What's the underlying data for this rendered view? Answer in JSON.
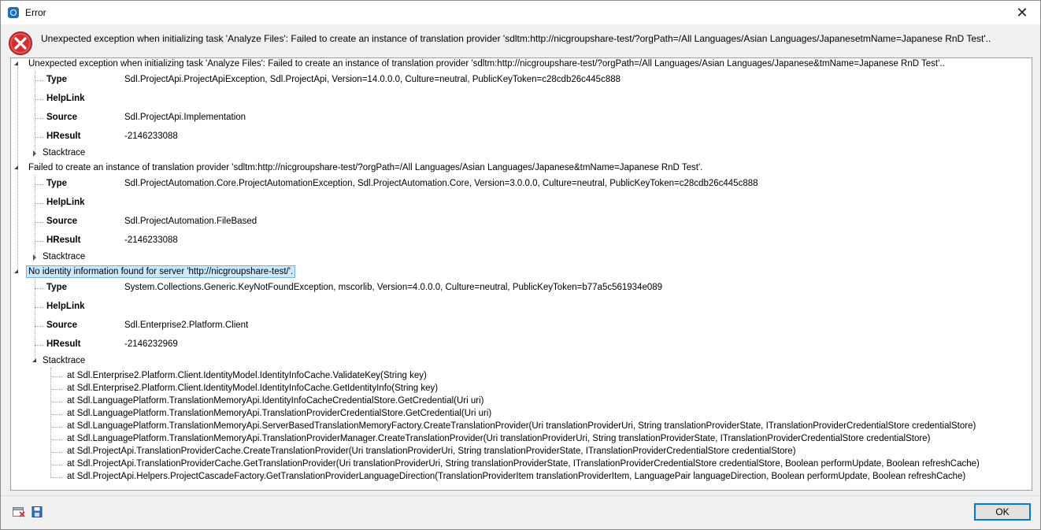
{
  "window": {
    "title": "Error",
    "close_glyph": "✕"
  },
  "header": {
    "message": "Unexpected exception when initializing task 'Analyze Files': Failed to create an instance of translation provider 'sdltm:http://nicgroupshare-test/?orgPath=/All Languages/Asian Languages/JapanesetmName=Japanese RnD Test'.."
  },
  "labels": {
    "type": "Type",
    "helplink": "HelpLink",
    "source": "Source",
    "hresult": "HResult",
    "stacktrace": "Stacktrace"
  },
  "exceptions": [
    {
      "title": "Unexpected exception when initializing task 'Analyze Files': Failed to create an instance of translation provider 'sdltm:http://nicgroupshare-test/?orgPath=/All Languages/Asian Languages/Japanese&tmName=Japanese RnD Test'..",
      "type": "Sdl.ProjectApi.ProjectApiException, Sdl.ProjectApi,  Version=14.0.0.0, Culture=neutral, PublicKeyToken=c28cdb26c445c888",
      "helplink": "",
      "source": "Sdl.ProjectApi.Implementation",
      "hresult": "-2146233088"
    },
    {
      "title": "Failed to create an instance of translation provider 'sdltm:http://nicgroupshare-test/?orgPath=/All Languages/Asian Languages/Japanese&tmName=Japanese RnD Test'.",
      "type": "Sdl.ProjectAutomation.Core.ProjectAutomationException, Sdl.ProjectAutomation.Core,  Version=3.0.0.0, Culture=neutral, PublicKeyToken=c28cdb26c445c888",
      "helplink": "",
      "source": "Sdl.ProjectAutomation.FileBased",
      "hresult": "-2146233088"
    },
    {
      "title": "No identity information found for server 'http://nicgroupshare-test/'.",
      "type": "System.Collections.Generic.KeyNotFoundException, mscorlib, Version=4.0.0.0, Culture=neutral, PublicKeyToken=b77a5c561934e089",
      "helplink": "",
      "source": "Sdl.Enterprise2.Platform.Client",
      "hresult": "-2146232969"
    }
  ],
  "stacktrace_lines": [
    "at Sdl.Enterprise2.Platform.Client.IdentityModel.IdentityInfoCache.ValidateKey(String key)",
    "at Sdl.Enterprise2.Platform.Client.IdentityModel.IdentityInfoCache.GetIdentityInfo(String key)",
    "at Sdl.LanguagePlatform.TranslationMemoryApi.IdentityInfoCacheCredentialStore.GetCredential(Uri uri)",
    "at Sdl.LanguagePlatform.TranslationMemoryApi.TranslationProviderCredentialStore.GetCredential(Uri uri)",
    "at Sdl.LanguagePlatform.TranslationMemoryApi.ServerBasedTranslationMemoryFactory.CreateTranslationProvider(Uri translationProviderUri, String translationProviderState, ITranslationProviderCredentialStore credentialStore)",
    "at Sdl.LanguagePlatform.TranslationMemoryApi.TranslationProviderManager.CreateTranslationProvider(Uri translationProviderUri, String translationProviderState, ITranslationProviderCredentialStore credentialStore)",
    "at Sdl.ProjectApi.TranslationProviderCache.CreateTranslationProvider(Uri translationProviderUri, String translationProviderState, ITranslationProviderCredentialStore credentialStore)",
    "at Sdl.ProjectApi.TranslationProviderCache.GetTranslationProvider(Uri translationProviderUri, String translationProviderState, ITranslationProviderCredentialStore credentialStore, Boolean performUpdate, Boolean refreshCache)",
    "at Sdl.ProjectApi.Helpers.ProjectCascadeFactory.GetTranslationProviderLanguageDirection(TranslationProviderItem translationProviderItem, LanguagePair languageDirection, Boolean performUpdate, Boolean refreshCache)"
  ],
  "footer": {
    "ok_label": "OK",
    "icons": [
      "clear-log-icon",
      "save-icon"
    ]
  },
  "colors": {
    "error_red": "#d32f2f",
    "selection": "#cce8ff",
    "accent": "#0078d7"
  }
}
